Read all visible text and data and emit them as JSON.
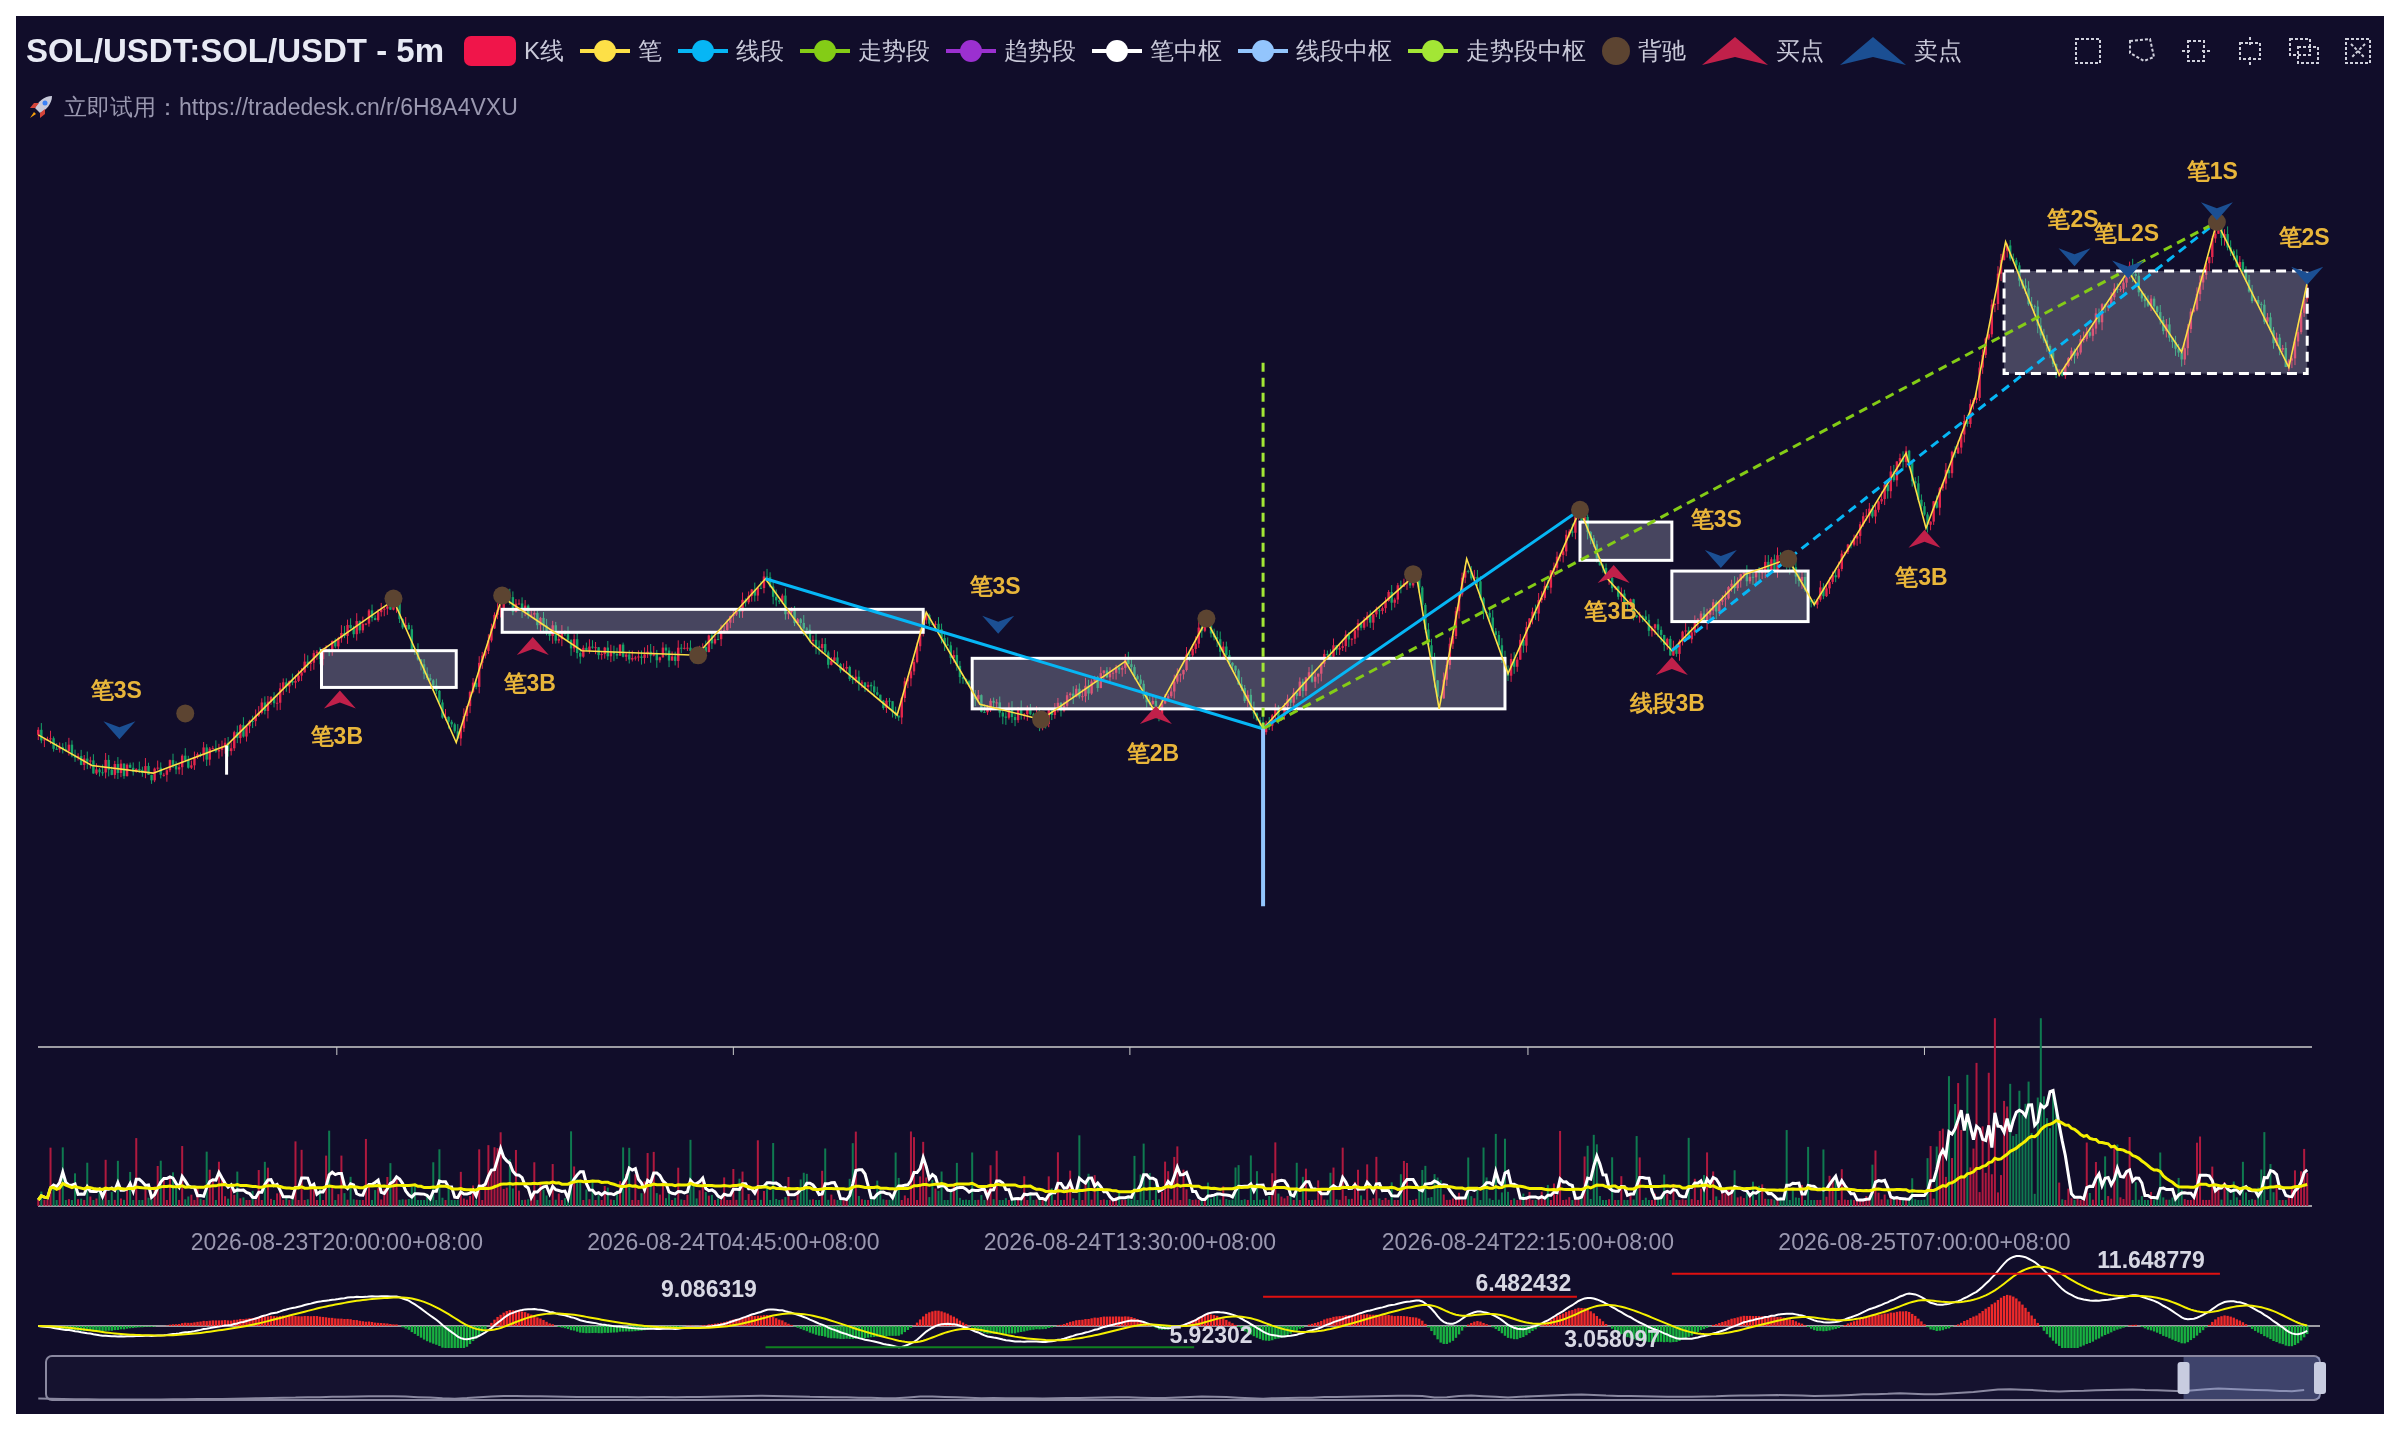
{
  "chart": {
    "title": "SOL/USDT:SOL/USDT - 5m",
    "subtitle": "立即试用：https://tradedesk.cn/r/6H8A4VXU"
  },
  "legend": [
    {
      "label": "K线",
      "kind": "candle",
      "color": "#f0154a"
    },
    {
      "label": "笔",
      "kind": "line",
      "color": "#fde047"
    },
    {
      "label": "线段",
      "kind": "line",
      "color": "#06b6f5"
    },
    {
      "label": "走势段",
      "kind": "line",
      "color": "#84cc16"
    },
    {
      "label": "趋势段",
      "kind": "line",
      "color": "#9b30d0"
    },
    {
      "label": "笔中枢",
      "kind": "line",
      "color": "#ffffff"
    },
    {
      "label": "线段中枢",
      "kind": "line",
      "color": "#93c5fd"
    },
    {
      "label": "走势段中枢",
      "kind": "line",
      "color": "#a3e635"
    },
    {
      "label": "背驰",
      "kind": "dot",
      "color": "#5c4431"
    },
    {
      "label": "买点",
      "kind": "arrow",
      "color": "#c0204a"
    },
    {
      "label": "卖点",
      "kind": "arrow",
      "color": "#1b4f93"
    }
  ],
  "signals": [
    {
      "label": "笔3S",
      "kind": "sell"
    },
    {
      "label": "笔3B",
      "kind": "buy"
    },
    {
      "label": "笔3B",
      "kind": "buy"
    },
    {
      "label": "笔3S",
      "kind": "sell"
    },
    {
      "label": "笔2B",
      "kind": "buy"
    },
    {
      "label": "笔3S",
      "kind": "sell"
    },
    {
      "label": "笔3B",
      "kind": "buy"
    },
    {
      "label": "线段3B",
      "kind": "buy"
    },
    {
      "label": "笔3B",
      "kind": "buy"
    },
    {
      "label": "笔2S",
      "kind": "sell"
    },
    {
      "label": "笔L2S",
      "kind": "sell"
    },
    {
      "label": "笔1S",
      "kind": "sell"
    },
    {
      "label": "笔2S",
      "kind": "sell"
    }
  ],
  "time_axis": [
    "2026-08-23T20:00:00+08:00",
    "2026-08-24T04:45:00+08:00",
    "2026-08-24T13:30:00+08:00",
    "2026-08-24T22:15:00+08:00",
    "2026-08-25T07:00:00+08:00"
  ],
  "data_zoom": {
    "level": 0.06
  },
  "macd_labels": [
    "9.086319",
    "5.92302",
    "6.482432",
    "3.058097",
    "11.648779"
  ]
}
